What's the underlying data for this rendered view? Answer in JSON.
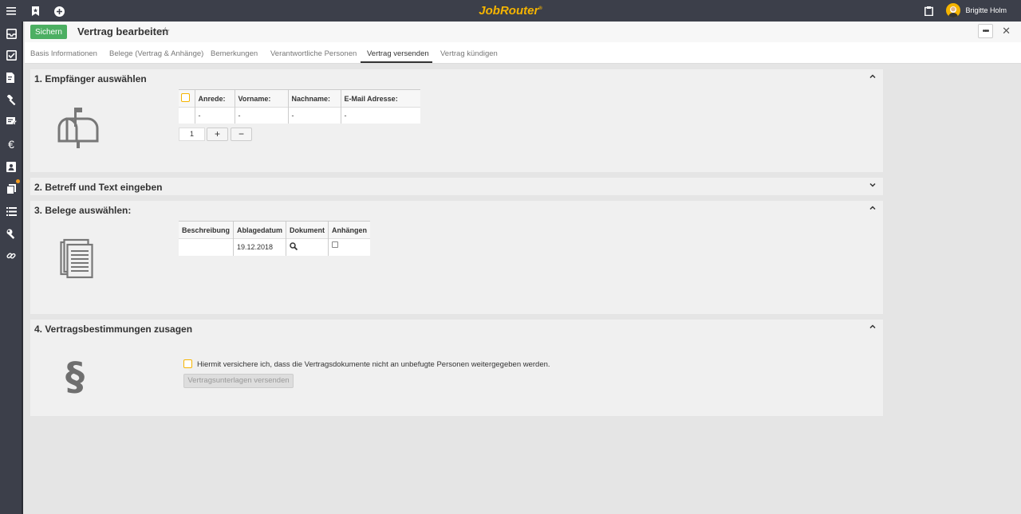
{
  "header": {
    "brand": "JobRouter",
    "brand_mark": "®",
    "user_name": "Brigitte Holm"
  },
  "toolbar": {
    "save_label": "Sichern",
    "title": "Vertrag bearbeiten",
    "more_label": "•••",
    "close_label": "✕"
  },
  "tabs": [
    {
      "label": "Basis Informationen"
    },
    {
      "label": "Belege (Vertrag & Anhänge)"
    },
    {
      "label": "Bemerkungen"
    },
    {
      "label": "Verantwortliche Personen"
    },
    {
      "label": "Vertrag versenden"
    },
    {
      "label": "Vertrag kündigen"
    }
  ],
  "section1": {
    "title": "1. Empfänger auswählen",
    "columns": [
      "Anrede:",
      "Vorname:",
      "Nachname:",
      "E-Mail Adresse:"
    ],
    "row": [
      "-",
      "-",
      "-",
      "-"
    ],
    "count": "1",
    "add_label": "+",
    "remove_label": "−"
  },
  "section2": {
    "title": "2. Betreff und Text eingeben"
  },
  "section3": {
    "title": "3. Belege auswählen:",
    "columns": [
      "Beschreibung",
      "Ablagedatum",
      "Dokument",
      "Anhängen"
    ],
    "row": {
      "beschreibung": "",
      "ablagedatum": "19.12.2018"
    }
  },
  "section4": {
    "title": "4. Vertragsbestimmungen zusagen",
    "paragraph_symbol": "§",
    "agree_text": "Hiermit versichere ich, dass die Vertragsdokumente nicht an unbefugte Personen weitergegeben werden.",
    "send_label": "Vertragsunterlagen versenden"
  },
  "colors": {
    "accent": "#f5b400",
    "save": "#4caf62",
    "sidebar": "#3c3f4a",
    "notification": "#f59b1c"
  }
}
